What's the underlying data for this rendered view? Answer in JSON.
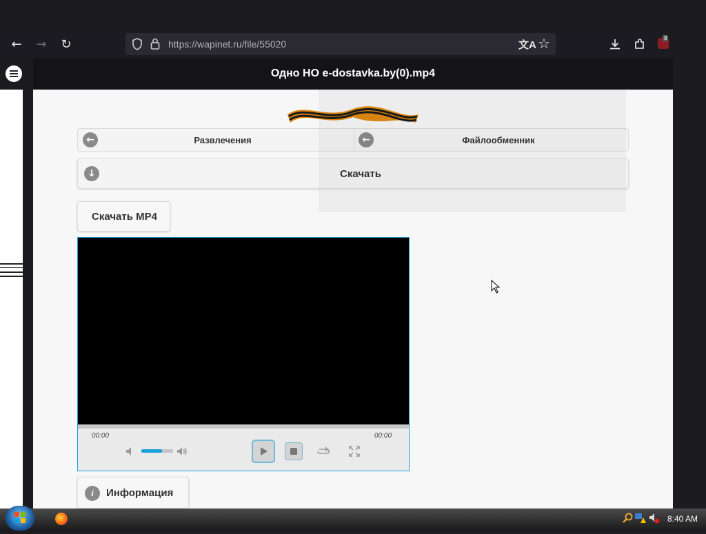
{
  "browser": {
    "url": "https://wapinet.ru/file/55020",
    "downloads_badge": "9"
  },
  "header": {
    "title": "Одно НО e-dostavka.by(0).mp4"
  },
  "nav": {
    "back_category": "Развлечения",
    "back_section": "Файлообменник",
    "download_toggle": "Скачать"
  },
  "download_button": "Скачать MP4",
  "player": {
    "time_current": "00:00",
    "time_total": "00:00",
    "volume_level": 0.65
  },
  "info_button": "Информация",
  "taskbar": {
    "clock": "8:40 AM"
  },
  "colors": {
    "accent": "#1aa1d9",
    "chrome_bg": "#1c1b22",
    "header_bg": "#141418"
  }
}
